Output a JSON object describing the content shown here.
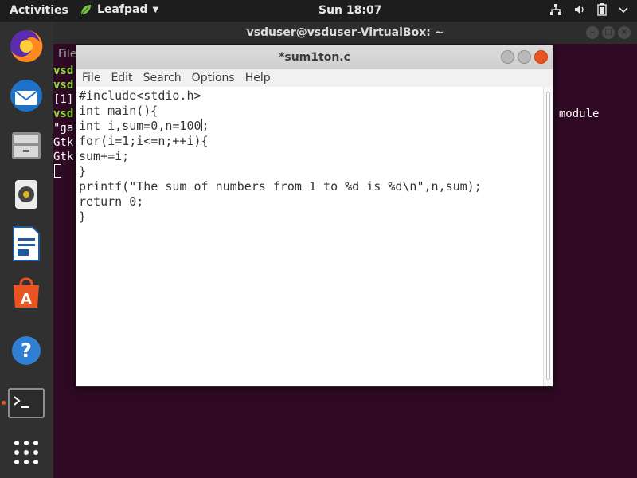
{
  "topbar": {
    "activities": "Activities",
    "app_name": "Leafpad",
    "clock": "Sun 18:07",
    "tray_icons": [
      "network-icon",
      "volume-icon",
      "battery-icon",
      "power-icon"
    ]
  },
  "dock": {
    "items": [
      "firefox-icon",
      "thunderbird-icon",
      "files-icon",
      "rhythmbox-icon",
      "writer-icon",
      "software-icon",
      "help-icon",
      "terminal-icon",
      "show-apps-icon"
    ],
    "active_color": "#e95420"
  },
  "terminal": {
    "title": "vsduser@vsduser-VirtualBox: ~",
    "menu_file": "File",
    "lines": [
      "vsd",
      "vsd",
      "[1]",
      "vsd",
      "\"ga",
      "Gtk",
      "Gtk"
    ],
    "right_text": "d module"
  },
  "editor": {
    "title": "*sum1ton.c",
    "menu": [
      "File",
      "Edit",
      "Search",
      "Options",
      "Help"
    ],
    "code": [
      "#include<stdio.h>",
      "int main(){",
      "int i,sum=0,n=100",
      "for(i=1;i<=n;++i){",
      "sum+=i;",
      "}",
      "printf(\"The sum of numbers from 1 to %d is %d\\n\",n,sum);",
      "return 0;",
      "}"
    ],
    "code_line3_tail": ";"
  }
}
